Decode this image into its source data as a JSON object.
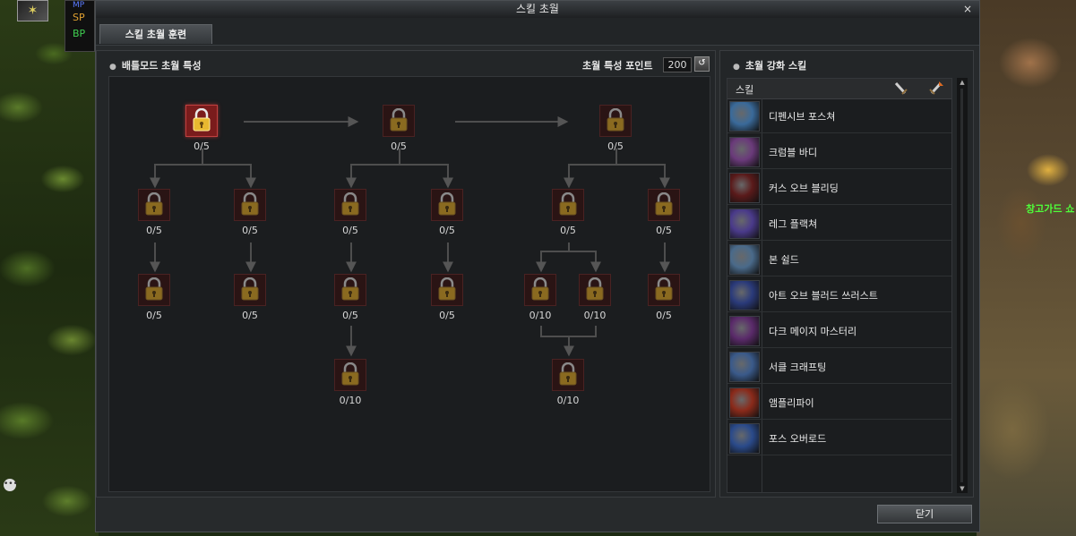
{
  "hud": {
    "mp_label": "MP",
    "sp_label": "SP",
    "bp_label": "BP",
    "npc_name": "창고가드 쇼"
  },
  "window": {
    "title": "스킬 초월",
    "close_glyph": "×",
    "tab_label": "스킬 초월 훈련"
  },
  "left_panel": {
    "title": "배틀모드 초월 특성",
    "points_label": "초월 특성 포인트",
    "points_value": "200",
    "refresh_glyph": "↺",
    "nodes": [
      {
        "count": "0/5",
        "active": true
      },
      {
        "count": "0/5"
      },
      {
        "count": "0/5"
      },
      {
        "count": "0/5"
      },
      {
        "count": "0/5"
      },
      {
        "count": "0/5"
      },
      {
        "count": "0/5"
      },
      {
        "count": "0/5"
      },
      {
        "count": "0/5"
      },
      {
        "count": "0/5"
      },
      {
        "count": "0/5"
      },
      {
        "count": "0/5"
      },
      {
        "count": "0/5"
      },
      {
        "count": "0/10"
      },
      {
        "count": "0/10"
      },
      {
        "count": "0/5"
      },
      {
        "count": "0/10"
      },
      {
        "count": "0/10"
      }
    ]
  },
  "right_panel": {
    "title": "초월 강화 스킬",
    "column_header": "스킬",
    "skills": [
      {
        "name": "디펜시브 포스쳐",
        "color": "#3a6a9a"
      },
      {
        "name": "크럼블 바디",
        "color": "#6a3a7a"
      },
      {
        "name": "커스 오브 블리딩",
        "color": "#5a1a1a"
      },
      {
        "name": "레그 플랙쳐",
        "color": "#4a3a8a"
      },
      {
        "name": "본 쉴드",
        "color": "#4a6a8a"
      },
      {
        "name": "아트 오브 블러드 쓰러스트",
        "color": "#2a3a7a"
      },
      {
        "name": "다크 메이지 마스터리",
        "color": "#5a2a6a"
      },
      {
        "name": "서클 크래프팅",
        "color": "#3a5a8a"
      },
      {
        "name": "앰플리파이",
        "color": "#8a2a1a"
      },
      {
        "name": "포스 오버로드",
        "color": "#2a4a8a"
      }
    ]
  },
  "footer": {
    "close_label": "닫기"
  }
}
